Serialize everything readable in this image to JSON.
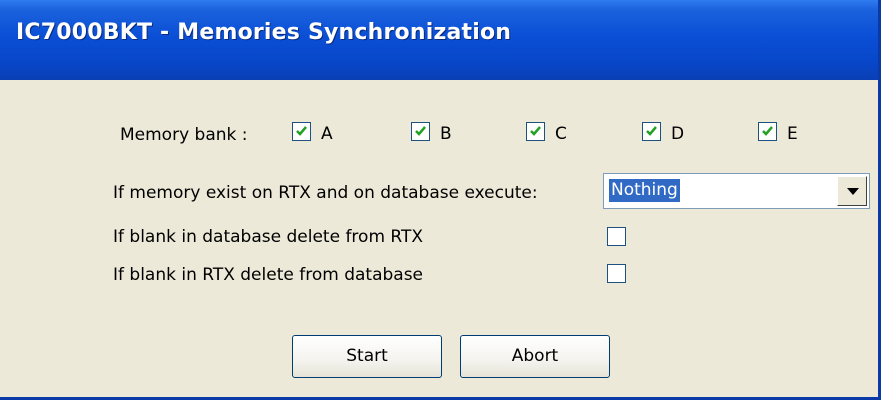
{
  "window": {
    "title": "IC7000BKT - Memories Synchronization"
  },
  "memory_bank": {
    "label": "Memory bank :",
    "banks": [
      {
        "name": "A",
        "checked": true
      },
      {
        "name": "B",
        "checked": true
      },
      {
        "name": "C",
        "checked": true
      },
      {
        "name": "D",
        "checked": true
      },
      {
        "name": "E",
        "checked": true
      }
    ]
  },
  "conflict": {
    "label": "If memory exist on RTX and on database execute:",
    "selected": "Nothing"
  },
  "options": {
    "blank_db_label": "If blank in database delete from RTX",
    "blank_db_checked": false,
    "blank_rtx_label": "If blank in RTX delete from database",
    "blank_rtx_checked": false
  },
  "buttons": {
    "start": "Start",
    "abort": "Abort"
  }
}
